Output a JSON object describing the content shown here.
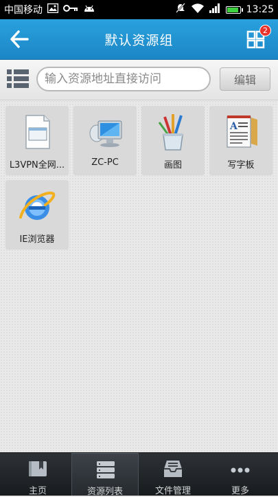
{
  "status_bar": {
    "carrier": "中国移动",
    "time": "13:25",
    "icons": [
      "image-icon",
      "key-icon",
      "android-icon",
      "mute-icon",
      "wifi-icon",
      "signal-icon",
      "battery-icon"
    ]
  },
  "header": {
    "title": "默认资源组",
    "badge_count": "2",
    "colors": {
      "header_bg": "#2196d6",
      "badge": "#e8332c"
    }
  },
  "search": {
    "placeholder": "输入资源地址直接访问",
    "value": "",
    "edit_label": "编辑"
  },
  "resources": [
    {
      "label": "L3VPN全网...",
      "icon": "document-window-icon"
    },
    {
      "label": "ZC-PC",
      "icon": "computer-icon"
    },
    {
      "label": "画图",
      "icon": "paint-icon"
    },
    {
      "label": "写字板",
      "icon": "wordpad-icon"
    },
    {
      "label": "IE浏览器",
      "icon": "internet-explorer-icon"
    }
  ],
  "bottom_nav": {
    "items": [
      {
        "label": "主页",
        "icon": "bookmark-home-icon",
        "active": false
      },
      {
        "label": "资源列表",
        "icon": "list-stack-icon",
        "active": true
      },
      {
        "label": "文件管理",
        "icon": "file-tray-icon",
        "active": false
      },
      {
        "label": "更多",
        "icon": "more-dots-icon",
        "active": false
      }
    ]
  }
}
